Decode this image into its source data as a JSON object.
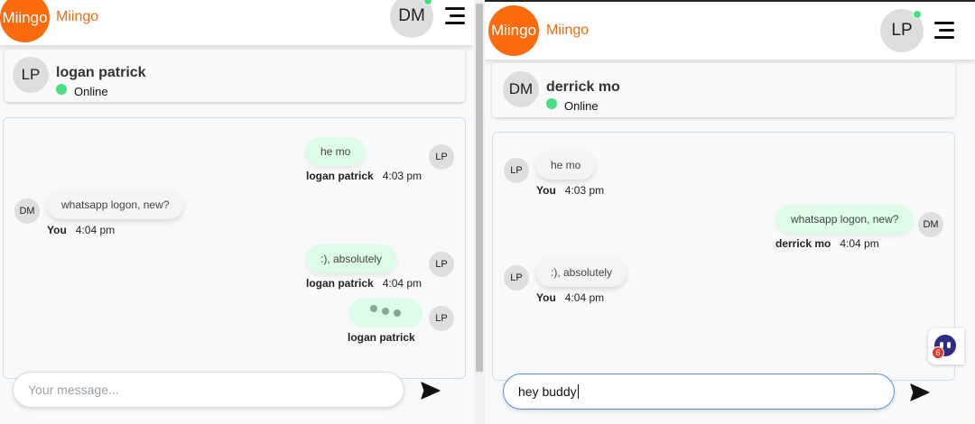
{
  "colors": {
    "brand": "#fb6a0c",
    "online": "#4ade80",
    "outgoing_bubble": "#dcfce7",
    "incoming_bubble": "#f3f4f6"
  },
  "left": {
    "header": {
      "logo_text": "Miingo",
      "brand_text": "Miingo",
      "user_initials": "DM",
      "menu_icon": "hamburger-menu-icon"
    },
    "contact": {
      "initials": "LP",
      "name": "logan patrick",
      "status": "Online"
    },
    "messages": [
      {
        "text": "he mo",
        "sender": "logan patrick",
        "time": "4:03 pm",
        "avatar": "LP"
      },
      {
        "text": "whatsapp logon, new?",
        "sender": "You",
        "time": "4:04 pm",
        "avatar": "DM"
      },
      {
        "text": ":), absolutely",
        "sender": "logan patrick",
        "time": "4:04 pm",
        "avatar": "LP"
      }
    ],
    "typing": {
      "sender": "logan patrick",
      "avatar": "LP"
    },
    "composer": {
      "placeholder": "Your message...",
      "value": "",
      "send_icon": "send-icon"
    }
  },
  "right": {
    "header": {
      "logo_text": "Miingo",
      "brand_text": "Miingo",
      "user_initials": "LP",
      "menu_icon": "hamburger-menu-icon"
    },
    "contact": {
      "initials": "DM",
      "name": "derrick mo",
      "status": "Online"
    },
    "messages": [
      {
        "text": "he mo",
        "sender": "You",
        "time": "4:03 pm",
        "avatar": "LP"
      },
      {
        "text": "whatsapp logon, new?",
        "sender": "derrick mo",
        "time": "4:04 pm",
        "avatar": "DM"
      },
      {
        "text": ":), absolutely",
        "sender": "You",
        "time": "4:04 pm",
        "avatar": "LP"
      }
    ],
    "composer": {
      "placeholder": "",
      "value": "hey buddy",
      "send_icon": "send-icon"
    },
    "help_widget": {
      "badge_count": "6",
      "icon": "support-bot-icon"
    }
  }
}
